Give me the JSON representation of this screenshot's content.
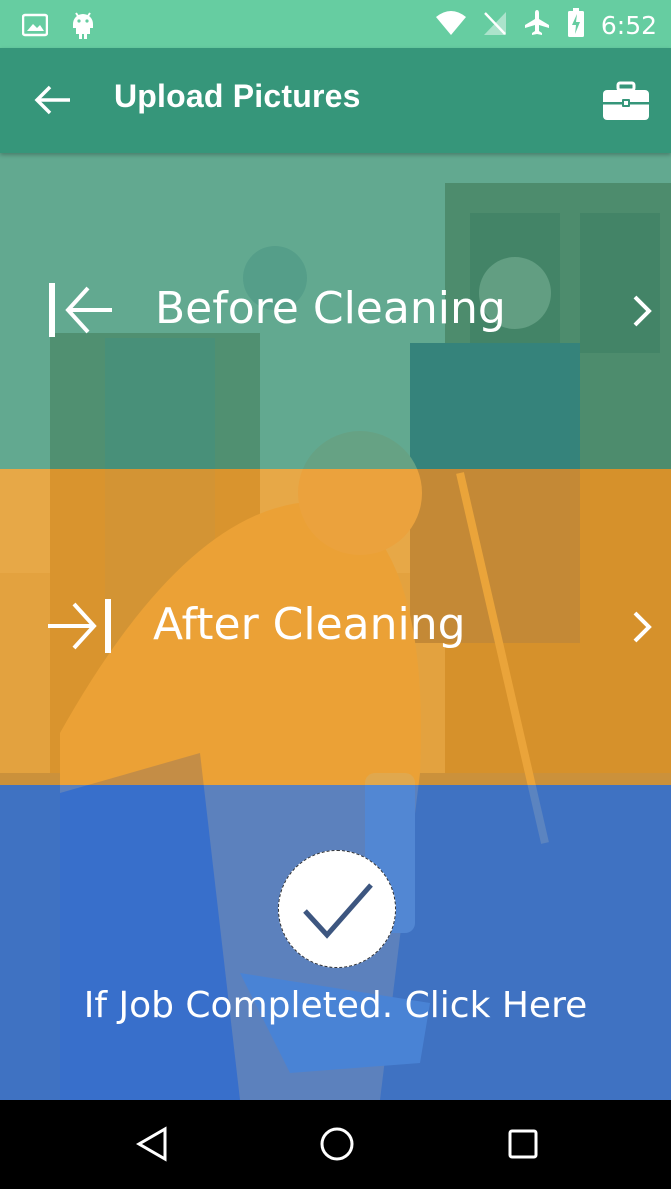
{
  "status_bar": {
    "time": "6:52",
    "left_icons": [
      "image-icon",
      "android-icon"
    ],
    "right_icons": [
      "wifi-icon",
      "no-signal-icon",
      "airplane-icon",
      "battery-charging-icon"
    ]
  },
  "app_bar": {
    "title": "Upload Pictures",
    "back_icon": "arrow-left-icon",
    "action_icon": "briefcase-icon"
  },
  "sections": {
    "before": {
      "label": "Before Cleaning",
      "icon": "arrow-to-left-bar-icon",
      "color": "#3aa082"
    },
    "after": {
      "label": "After Cleaning",
      "icon": "arrow-to-right-bar-icon",
      "color": "#f0a028"
    },
    "complete": {
      "label": "If Job Completed. Click Here",
      "icon": "checkmark-icon",
      "color": "#3c78d2"
    }
  },
  "nav_bar": {
    "buttons": [
      "back-triangle-icon",
      "home-circle-icon",
      "recents-square-icon"
    ]
  },
  "colors": {
    "status_bar": "#66cda1",
    "app_bar": "#36967a"
  }
}
